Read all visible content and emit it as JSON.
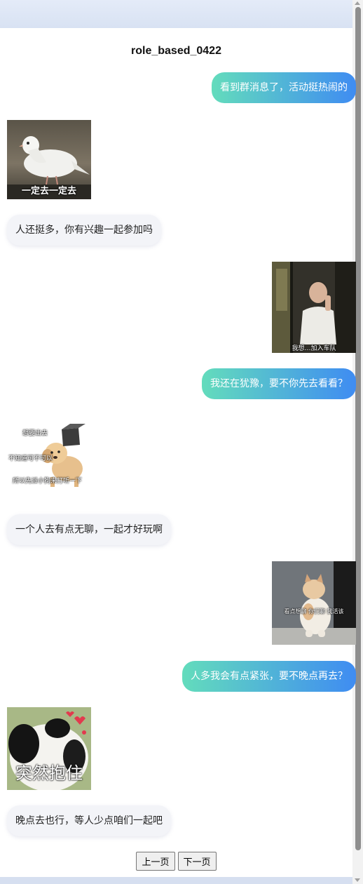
{
  "title": "role_based_0422",
  "messages": [
    {
      "side": "right",
      "type": "text",
      "text": "看到群消息了，活动挺热闹的"
    },
    {
      "side": "left",
      "type": "sticker",
      "icon": "white-pigeon-sticker",
      "caption": "一定去一定去"
    },
    {
      "side": "left",
      "type": "text",
      "text": "人还挺多，你有兴趣一起参加吗"
    },
    {
      "side": "right",
      "type": "sticker",
      "icon": "man-on-phone-sticker",
      "caption": "我想…加入车队"
    },
    {
      "side": "right",
      "type": "text",
      "text": "我还在犹豫，要不你先去看看？"
    },
    {
      "side": "left",
      "type": "sticker",
      "icon": "puppy-with-box-sticker",
      "caption_lines": [
        "想要出去",
        "不知道可不可以",
        "所以先派小狗来打听一下"
      ]
    },
    {
      "side": "left",
      "type": "text",
      "text": "一个人去有点无聊，一起才好玩啊"
    },
    {
      "side": "right",
      "type": "sticker",
      "icon": "sitting-cat-sticker",
      "caption": "看点想聊 你们聊 我活该"
    },
    {
      "side": "right",
      "type": "text",
      "text": "人多我会有点紧张，要不晚点再去？"
    },
    {
      "side": "left",
      "type": "sticker",
      "icon": "panda-hug-sticker",
      "caption": "突然抱住"
    },
    {
      "side": "left",
      "type": "text",
      "text": "晚点去也行，等人少点咱们一起吧"
    }
  ],
  "pager": {
    "prev": "上一页",
    "next": "下一页"
  },
  "colors": {
    "accent_start": "#63dcbc",
    "accent_end": "#3f8cf2",
    "left_bubble": "#f3f4f8"
  }
}
